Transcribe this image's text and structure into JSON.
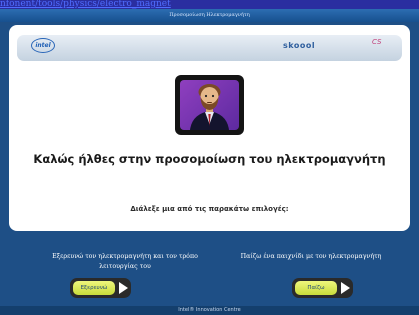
{
  "top_link": "nfonent/tools/physics/electro_magnet",
  "window": {
    "title": "Προσομοίωση Ηλεκτρομαγνήτη"
  },
  "header": {
    "left_logo": "intel",
    "right_logo_1": "skoool",
    "right_logo_2": "CS"
  },
  "main": {
    "welcome": "Καλώς ήλθες στην προσομοίωση του ηλεκτρομαγνήτη",
    "instruction": "Διάλεξε μια από τις παρακάτω επιλογές:"
  },
  "options": [
    {
      "description": "Εξερευνώ τον ηλεκτρομαγνήτη και τον τρόπο λειτουργίας του",
      "button_label": "Εξερευνώ"
    },
    {
      "description": "Παίζω ένα παιχνίδι με τον ηλεκτρομαγνήτη",
      "button_label": "Παίζω"
    }
  ],
  "footer": {
    "text": "Intel® Innovation Centre"
  },
  "colors": {
    "background": "#1e4f86",
    "button_face": "#e4ef5a",
    "avatar_bg": "#7a35b0"
  },
  "icons": {
    "play_arrow": "right-triangle",
    "avatar": "bearded-teacher-avatar"
  }
}
